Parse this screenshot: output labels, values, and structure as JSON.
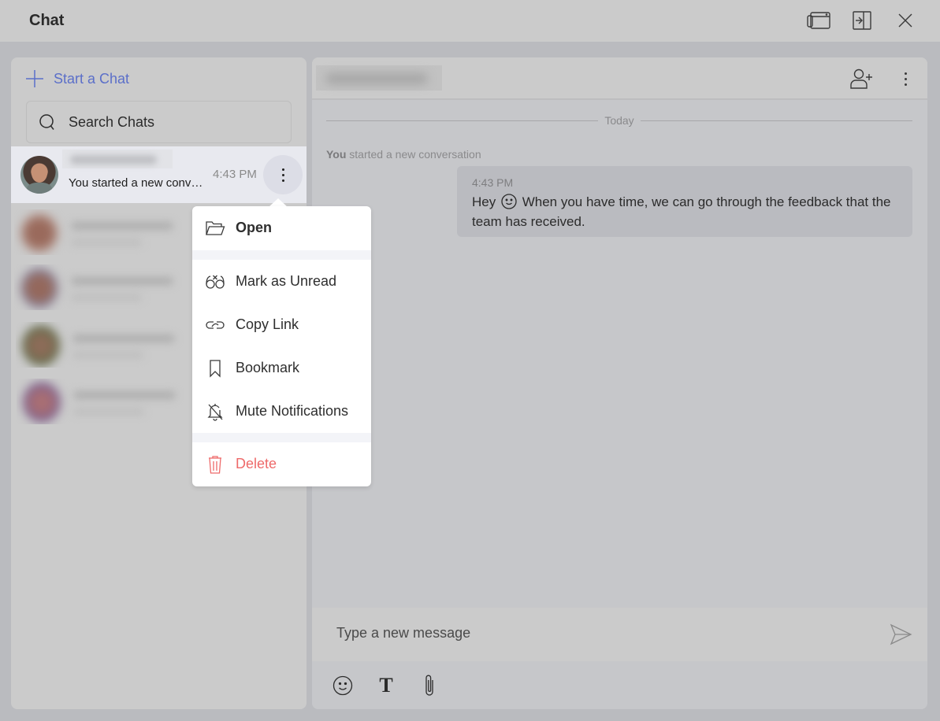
{
  "window": {
    "title": "Chat",
    "controls": [
      {
        "name": "popout-window-icon",
        "label": "Pop out"
      },
      {
        "name": "dock-panel-icon",
        "label": "Dock"
      },
      {
        "name": "close-icon",
        "label": "Close"
      }
    ]
  },
  "sidebar": {
    "start_chat_label": "Start a Chat",
    "search_placeholder": "Search Chats",
    "active_chat": {
      "name": "[blurred]",
      "preview": "You started a new conv…",
      "time": "4:43 PM"
    },
    "other_chats_count": 4
  },
  "context_menu": {
    "items": [
      {
        "label": "Open",
        "icon": "folder-open-icon",
        "group": 1,
        "style": "bold"
      },
      {
        "label": "Mark as Unread",
        "icon": "glasses-icon",
        "group": 2,
        "style": "normal"
      },
      {
        "label": "Copy Link",
        "icon": "link-icon",
        "group": 2,
        "style": "normal"
      },
      {
        "label": "Bookmark",
        "icon": "bookmark-icon",
        "group": 2,
        "style": "normal"
      },
      {
        "label": "Mute Notifications",
        "icon": "bell-off-icon",
        "group": 2,
        "style": "normal"
      },
      {
        "label": "Delete",
        "icon": "trash-icon",
        "group": 3,
        "style": "danger"
      }
    ]
  },
  "conversation": {
    "header_name": "[blurred]",
    "date_separator": "Today",
    "system_message_actor": "You",
    "system_message_text": " started a new conversation",
    "messages": [
      {
        "time": "4:43 PM",
        "text_before_emoji": "Hey",
        "emoji": "smile",
        "text_after_emoji": "When you have time, we can go through the feedback that the team has received."
      }
    ],
    "compose_placeholder": "Type a new message"
  },
  "colors": {
    "accent": "#5b6fc9",
    "danger": "#ee6a6a",
    "overlay_bg": "#babbbf"
  }
}
